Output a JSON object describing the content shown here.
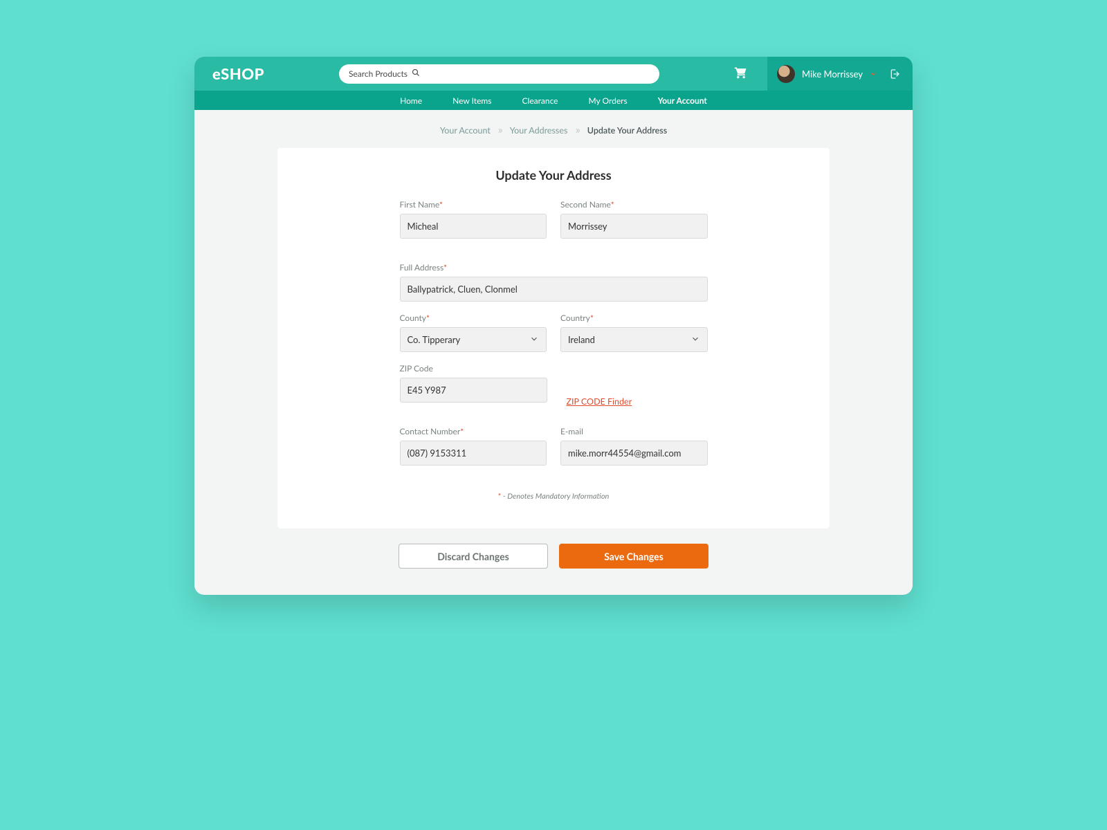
{
  "header": {
    "logo": "eSHOP",
    "search_placeholder": "Search Products",
    "user_name": "Mike Morrissey"
  },
  "nav": {
    "items": [
      "Home",
      "New Items",
      "Clearance",
      "My Orders",
      "Your Account"
    ],
    "active_index": 4
  },
  "breadcrumb": {
    "a": "Your Account",
    "b": "Your Addresses",
    "c": "Update Your Address"
  },
  "form": {
    "title": "Update Your Address",
    "first_name_label": "First Name",
    "first_name_value": "Micheal",
    "second_name_label": "Second Name",
    "second_name_value": "Morrissey",
    "full_address_label": "Full Address",
    "full_address_value": "Ballypatrick, Cluen, Clonmel",
    "county_label": "County",
    "county_value": "Co. Tipperary",
    "country_label": "Country",
    "country_value": "Ireland",
    "zip_label": "ZIP Code",
    "zip_value": "E45 Y987",
    "zip_link": "ZIP CODE Finder",
    "contact_label": "Contact Number",
    "contact_value": "(087) 9153311",
    "email_label": "E-mail",
    "email_value": "mike.morr44554@gmail.com",
    "mandatory_note": " - Denotes Mandatory Information"
  },
  "buttons": {
    "discard": "Discard Changes",
    "save": "Save Changes"
  }
}
